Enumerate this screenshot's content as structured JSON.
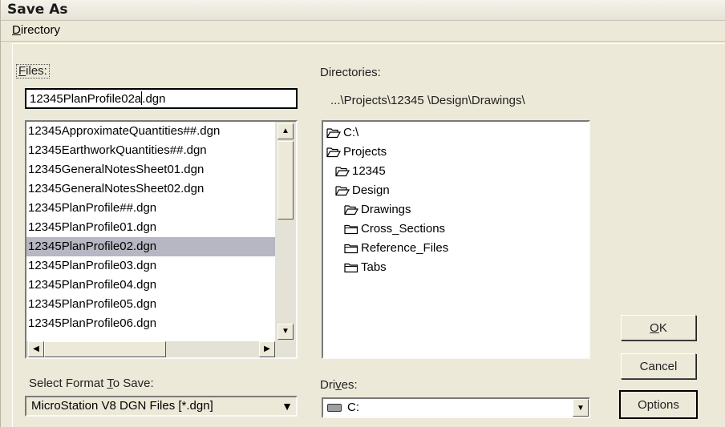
{
  "window": {
    "title": "Save As"
  },
  "menu": {
    "directory_pre": "",
    "directory_ul": "D",
    "directory_post": "irectory"
  },
  "files": {
    "label_ul": "F",
    "label_post": "iles:",
    "input_value_before_caret": "12345PlanProfile02a",
    "input_value_after_caret": "dgn",
    "input_value_sep": ".",
    "list": [
      "12345ApproximateQuantities##.dgn",
      "12345EarthworkQuantities##.dgn",
      "12345GeneralNotesSheet01.dgn",
      "12345GeneralNotesSheet02.dgn",
      "12345PlanProfile##.dgn",
      "12345PlanProfile01.dgn",
      "12345PlanProfile02.dgn",
      "12345PlanProfile03.dgn",
      "12345PlanProfile04.dgn",
      "12345PlanProfile05.dgn",
      "12345PlanProfile06.dgn"
    ],
    "selected_index": 6
  },
  "directories": {
    "label": "Directories:",
    "current_path": "...\\Projects\\12345 \\Design\\Drawings\\",
    "tree": [
      {
        "label": "C:\\",
        "open": true
      },
      {
        "label": "Projects",
        "open": true
      },
      {
        "label": "12345",
        "open": true
      },
      {
        "label": "Design",
        "open": true
      },
      {
        "label": "Drawings",
        "open": true
      },
      {
        "label": "Cross_Sections",
        "open": false
      },
      {
        "label": "Reference_Files",
        "open": false
      },
      {
        "label": "Tabs",
        "open": false
      }
    ]
  },
  "format": {
    "label_pre": "Select Format ",
    "label_ul": "T",
    "label_post": "o Save:",
    "selected": "MicroStation V8 DGN Files [*.dgn]"
  },
  "drives": {
    "label_pre": "Dri",
    "label_ul": "v",
    "label_post": "es:",
    "selected": "C:"
  },
  "buttons": {
    "ok_ul": "O",
    "ok_post": "K",
    "cancel": "Cancel",
    "options": "Options"
  },
  "colors": {
    "dialog_bg": "#ece9d8",
    "selection": "#b7b7c3",
    "folder_fill": "#ffffff",
    "folder_stroke": "#000000"
  }
}
